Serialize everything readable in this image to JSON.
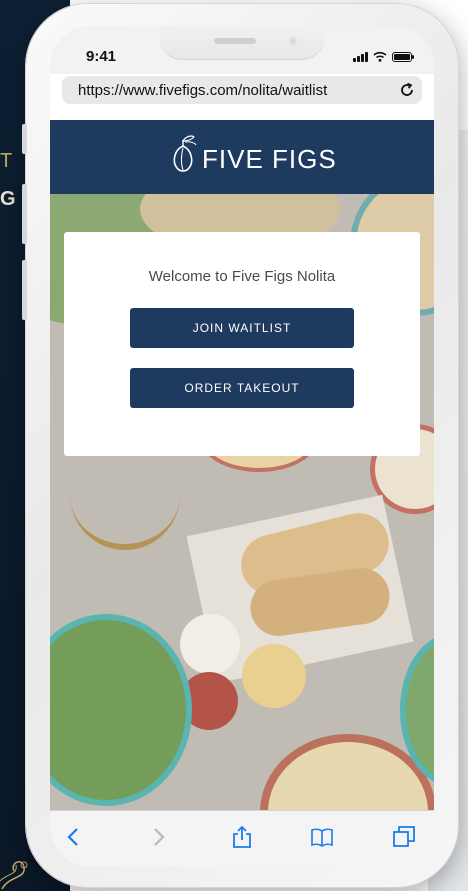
{
  "backdrop": {
    "left_fragment_1": "T",
    "left_fragment_2": "G"
  },
  "status_bar": {
    "time": "9:41",
    "icons": [
      "signal-icon",
      "wifi-icon",
      "battery-icon"
    ]
  },
  "browser": {
    "url": "https://www.fivefigs.com/nolita/waitlist",
    "reload_icon": "reload-icon"
  },
  "site": {
    "logo_text": "FIVE FIGS",
    "logo_icon": "fig-logo-icon",
    "brand_color": "#1f3a5f"
  },
  "card": {
    "title": "Welcome to Five Figs Nolita",
    "join_label": "JOIN WAITLIST",
    "takeout_label": "ORDER TAKEOUT"
  },
  "toolbar": {
    "icons": [
      "back-icon",
      "forward-icon",
      "share-icon",
      "bookmarks-icon",
      "tabs-icon"
    ]
  }
}
